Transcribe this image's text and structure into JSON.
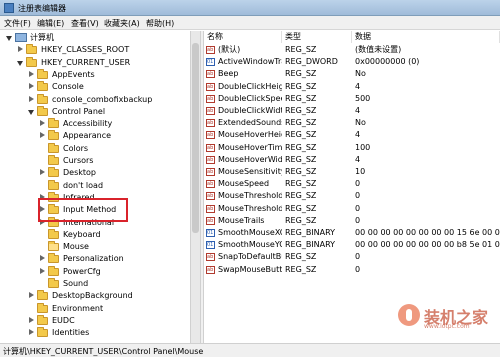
{
  "window": {
    "title": "注册表编辑器"
  },
  "menu": [
    "文件(F)",
    "编辑(E)",
    "查看(V)",
    "收藏夹(A)",
    "帮助(H)"
  ],
  "tree": [
    {
      "label": "计算机",
      "kind": "computer",
      "state": "expanded"
    },
    {
      "label": "HKEY_CLASSES_ROOT",
      "kind": "folder",
      "state": "collapsed"
    },
    {
      "label": "HKEY_CURRENT_USER",
      "kind": "folder",
      "state": "expanded"
    },
    {
      "label": "AppEvents",
      "kind": "folder",
      "state": "collapsed"
    },
    {
      "label": "Console",
      "kind": "folder",
      "state": "collapsed"
    },
    {
      "label": "console_combofixbackup",
      "kind": "folder",
      "state": "collapsed"
    },
    {
      "label": "Control Panel",
      "kind": "folder",
      "state": "expanded"
    },
    {
      "label": "Accessibility",
      "kind": "folder",
      "state": "collapsed"
    },
    {
      "label": "Appearance",
      "kind": "folder",
      "state": "collapsed"
    },
    {
      "label": "Colors",
      "kind": "folder",
      "state": "none"
    },
    {
      "label": "Cursors",
      "kind": "folder",
      "state": "none"
    },
    {
      "label": "Desktop",
      "kind": "folder",
      "state": "collapsed"
    },
    {
      "label": "don't load",
      "kind": "folder",
      "state": "none"
    },
    {
      "label": "Infrared",
      "kind": "folder",
      "state": "collapsed"
    },
    {
      "label": "Input Method",
      "kind": "folder",
      "state": "collapsed"
    },
    {
      "label": "International",
      "kind": "folder",
      "state": "collapsed"
    },
    {
      "label": "Keyboard",
      "kind": "folder",
      "state": "none"
    },
    {
      "label": "Mouse",
      "kind": "folder-open",
      "state": "none",
      "selected": true
    },
    {
      "label": "Personalization",
      "kind": "folder",
      "state": "collapsed"
    },
    {
      "label": "PowerCfg",
      "kind": "folder",
      "state": "collapsed"
    },
    {
      "label": "Sound",
      "kind": "folder",
      "state": "none"
    },
    {
      "label": "DesktopBackground",
      "kind": "folder",
      "state": "collapsed"
    },
    {
      "label": "Environment",
      "kind": "folder",
      "state": "none"
    },
    {
      "label": "EUDC",
      "kind": "folder",
      "state": "collapsed"
    },
    {
      "label": "Identities",
      "kind": "folder",
      "state": "collapsed"
    }
  ],
  "columns": {
    "name": "名称",
    "type": "类型",
    "data": "数据"
  },
  "values": [
    {
      "icon": "string-value-icon",
      "name": "(默认)",
      "type": "REG_SZ",
      "data": "(数值未设置)"
    },
    {
      "icon": "binary-value-icon",
      "name": "ActiveWindowTracking",
      "type": "REG_DWORD",
      "data": "0x00000000 (0)"
    },
    {
      "icon": "string-value-icon",
      "name": "Beep",
      "type": "REG_SZ",
      "data": "No"
    },
    {
      "icon": "string-value-icon",
      "name": "DoubleClickHeight",
      "type": "REG_SZ",
      "data": "4"
    },
    {
      "icon": "string-value-icon",
      "name": "DoubleClickSpeed",
      "type": "REG_SZ",
      "data": "500"
    },
    {
      "icon": "string-value-icon",
      "name": "DoubleClickWidth",
      "type": "REG_SZ",
      "data": "4"
    },
    {
      "icon": "string-value-icon",
      "name": "ExtendedSounds",
      "type": "REG_SZ",
      "data": "No"
    },
    {
      "icon": "string-value-icon",
      "name": "MouseHoverHeight",
      "type": "REG_SZ",
      "data": "4"
    },
    {
      "icon": "string-value-icon",
      "name": "MouseHoverTime",
      "type": "REG_SZ",
      "data": "100"
    },
    {
      "icon": "string-value-icon",
      "name": "MouseHoverWidth",
      "type": "REG_SZ",
      "data": "4"
    },
    {
      "icon": "string-value-icon",
      "name": "MouseSensitivity",
      "type": "REG_SZ",
      "data": "10"
    },
    {
      "icon": "string-value-icon",
      "name": "MouseSpeed",
      "type": "REG_SZ",
      "data": "0"
    },
    {
      "icon": "string-value-icon",
      "name": "MouseThreshold1",
      "type": "REG_SZ",
      "data": "0"
    },
    {
      "icon": "string-value-icon",
      "name": "MouseThreshold2",
      "type": "REG_SZ",
      "data": "0"
    },
    {
      "icon": "string-value-icon",
      "name": "MouseTrails",
      "type": "REG_SZ",
      "data": "0"
    },
    {
      "icon": "binary-value-icon",
      "name": "SmoothMouseXCurve",
      "type": "REG_BINARY",
      "data": "00 00 00 00 00 00 00 00 15 6e 00 00 00"
    },
    {
      "icon": "binary-value-icon",
      "name": "SmoothMouseYCurve",
      "type": "REG_BINARY",
      "data": "00 00 00 00 00 00 00 00 b8 5e 01 00 00"
    },
    {
      "icon": "string-value-icon",
      "name": "SnapToDefaultButton",
      "type": "REG_SZ",
      "data": "0"
    },
    {
      "icon": "string-value-icon",
      "name": "SwapMouseButtons",
      "type": "REG_SZ",
      "data": "0"
    }
  ],
  "status": {
    "path": "计算机\\HKEY_CURRENT_USER\\Control Panel\\Mouse"
  },
  "watermark": {
    "brand": "装机之家",
    "url": "www.lotpc.com"
  },
  "colors": {
    "highlight": "#d9232b",
    "folder": "#f3c94a"
  }
}
